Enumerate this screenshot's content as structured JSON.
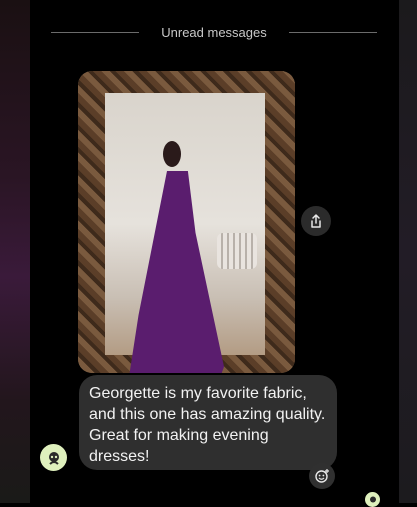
{
  "chat": {
    "divider_label": "Unread messages",
    "message_text": "Georgette is my favorite fabric, and this one has amazing quality. Great for making evening dresses!"
  },
  "icons": {
    "share": "share-icon",
    "avatar": "avatar-icon",
    "reaction": "add-reaction-icon"
  },
  "colors": {
    "background": "#000000",
    "bubble": "#2f2f2f",
    "avatar": "#dff0bd",
    "dress": "#5a1d6e"
  }
}
